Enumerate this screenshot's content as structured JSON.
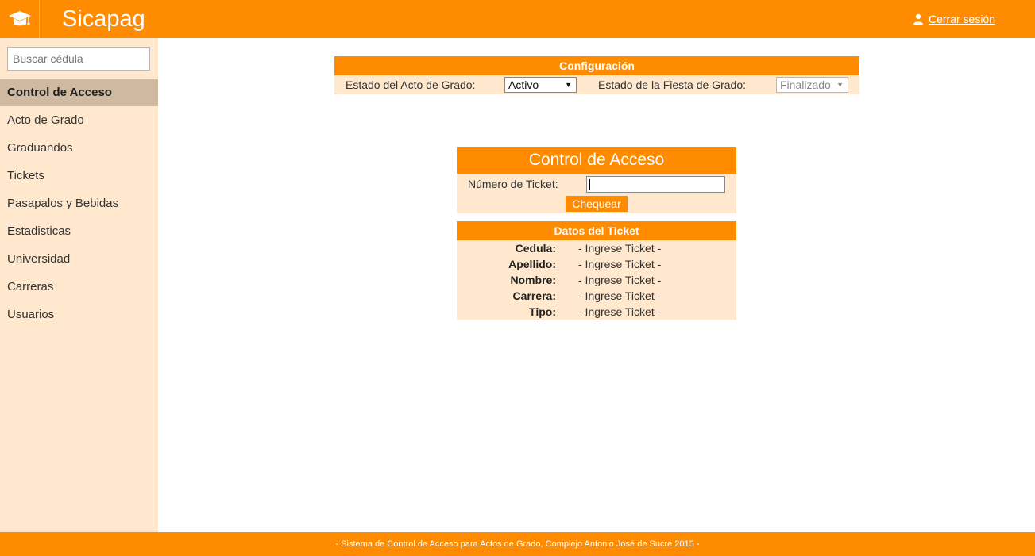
{
  "header": {
    "brand": "Sicapag",
    "logout_label": "Cerrar sesión"
  },
  "sidebar": {
    "search_placeholder": "Buscar cédula",
    "items": [
      {
        "label": "Control de Acceso",
        "active": true
      },
      {
        "label": "Acto de Grado"
      },
      {
        "label": "Graduandos"
      },
      {
        "label": "Tickets"
      },
      {
        "label": "Pasapalos y Bebidas"
      },
      {
        "label": "Estadisticas"
      },
      {
        "label": "Universidad"
      },
      {
        "label": "Carreras"
      },
      {
        "label": "Usuarios"
      }
    ]
  },
  "config": {
    "title": "Configuración",
    "acto_label": "Estado del Acto de Grado:",
    "acto_value": "Activo",
    "fiesta_label": "Estado de la Fiesta de Grado:",
    "fiesta_value": "Finalizado"
  },
  "access": {
    "title": "Control de Acceso",
    "ticket_label": "Número de Ticket:",
    "ticket_value": "",
    "check_label": "Chequear"
  },
  "ticket_data": {
    "title": "Datos del Ticket",
    "rows": [
      {
        "key": "Cedula:",
        "value": "- Ingrese Ticket -"
      },
      {
        "key": "Apellido:",
        "value": "- Ingrese Ticket -"
      },
      {
        "key": "Nombre:",
        "value": "- Ingrese Ticket -"
      },
      {
        "key": "Carrera:",
        "value": "- Ingrese Ticket -"
      },
      {
        "key": "Tipo:",
        "value": "- Ingrese Ticket -"
      }
    ]
  },
  "footer": {
    "text": "-  Sistema de Control de Acceso para Actos de Grado, Complejo Antonio José de Sucre 2015  -"
  },
  "colors": {
    "accent": "#ff8c00",
    "panel_bg": "#ffe8ce",
    "active_item": "#cfb9a0"
  },
  "icons": {
    "logo": "graduation-cap-icon",
    "logout": "user-icon"
  }
}
